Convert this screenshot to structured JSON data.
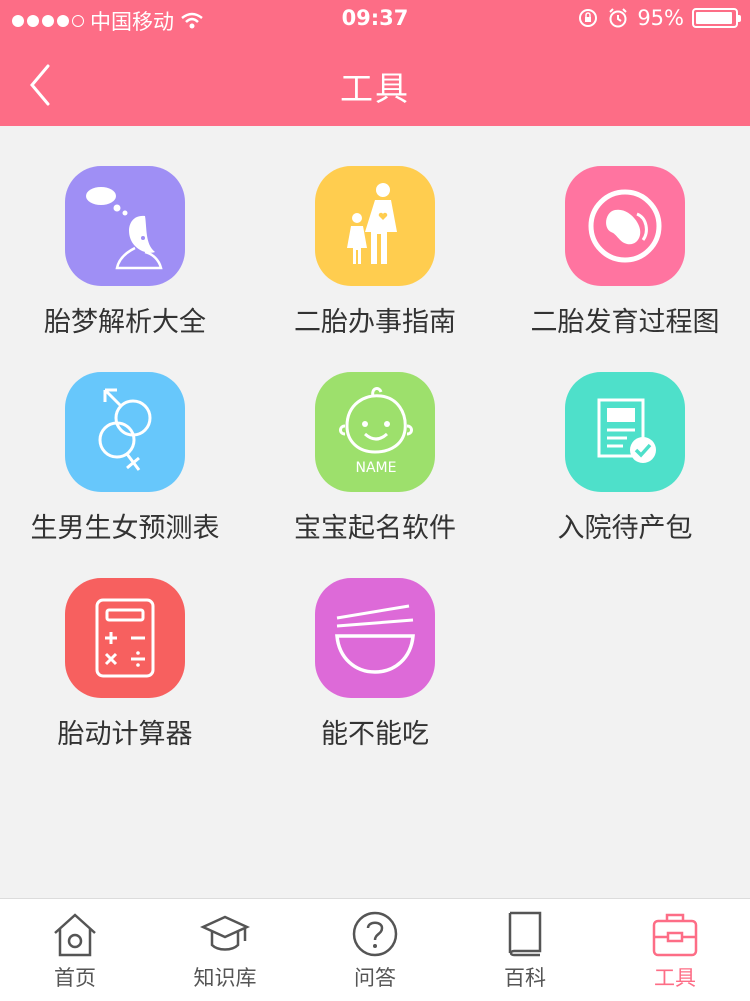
{
  "status_bar": {
    "carrier": "中国移动",
    "time": "09:37",
    "battery": "95%",
    "battery_level": 0.95
  },
  "header": {
    "title": "工具",
    "color": "#fd6d86"
  },
  "tools": [
    {
      "label": "胎梦解析大全",
      "color": "#9f8ff5",
      "icon": "dreaming-girl-icon"
    },
    {
      "label": "二胎办事指南",
      "color": "#ffcd4f",
      "icon": "parent-child-icon"
    },
    {
      "label": "二胎发育过程图",
      "color": "#ff74a0",
      "icon": "fetus-icon"
    },
    {
      "label": "生男生女预测表",
      "color": "#67c7fb",
      "icon": "gender-symbols-icon"
    },
    {
      "label": "宝宝起名软件",
      "color": "#9de06c",
      "icon": "baby-face-icon",
      "icon_text": "NAME"
    },
    {
      "label": "入院待产包",
      "color": "#4ee0ca",
      "icon": "checklist-icon"
    },
    {
      "label": "胎动计算器",
      "color": "#f7605f",
      "icon": "calculator-icon"
    },
    {
      "label": "能不能吃",
      "color": "#dd6ad8",
      "icon": "bowl-chopsticks-icon"
    }
  ],
  "tabbar": {
    "items": [
      {
        "label": "首页",
        "icon": "home-icon",
        "active": false
      },
      {
        "label": "知识库",
        "icon": "graduation-cap-icon",
        "active": false
      },
      {
        "label": "问答",
        "icon": "question-icon",
        "active": false
      },
      {
        "label": "百科",
        "icon": "book-icon",
        "active": false
      },
      {
        "label": "工具",
        "icon": "toolbox-icon",
        "active": true
      }
    ]
  }
}
